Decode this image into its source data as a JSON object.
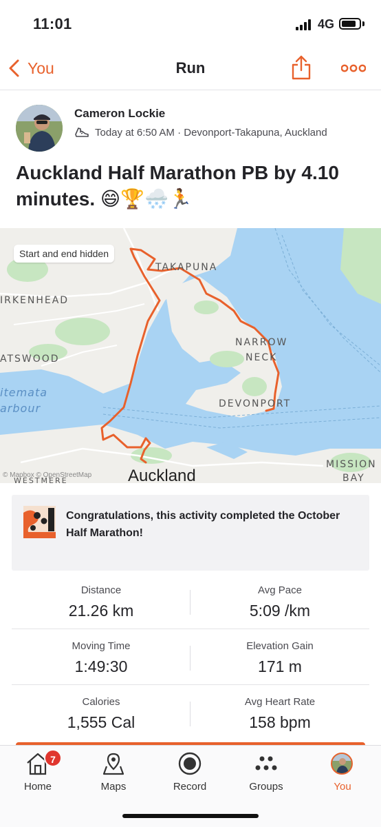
{
  "status_bar": {
    "time": "11:01",
    "network": "4G"
  },
  "nav": {
    "back_label": "You",
    "title": "Run"
  },
  "activity": {
    "athlete_name": "Cameron Lockie",
    "meta": "Today at 6:50 AM · Devonport-Takapuna, Auckland",
    "title": "Auckland Half Marathon PB by 4.10 minutes. 😄🏆🌨️🏃"
  },
  "map": {
    "privacy_chip": "Start and end hidden",
    "labels": {
      "takapuna": "TAKAPUNA",
      "birkenhead": "IRKENHEAD",
      "narrow": "NARROW",
      "neck": "NECK",
      "devonport": "DEVONPORT",
      "atswood": "ATSWOOD",
      "waitemata": "itemata",
      "harbour": "arbour",
      "mission": "MISSION",
      "bay": "BAY",
      "auckland": "Auckland",
      "westmere": "WESTMERE"
    },
    "attribution": "© Mapbox © OpenStreetMap"
  },
  "challenge": {
    "text": "Congratulations, this activity completed the October Half Marathon!"
  },
  "stats": [
    {
      "left": {
        "label": "Distance",
        "value": "21.26 km"
      },
      "right": {
        "label": "Avg Pace",
        "value": "5:09 /km"
      }
    },
    {
      "left": {
        "label": "Moving Time",
        "value": "1:49:30"
      },
      "right": {
        "label": "Elevation Gain",
        "value": "171 m"
      }
    },
    {
      "left": {
        "label": "Calories",
        "value": "1,555 Cal"
      },
      "right": {
        "label": "Avg Heart Rate",
        "value": "158 bpm"
      }
    }
  ],
  "tabs": [
    {
      "label": "Home",
      "icon": "home-icon",
      "badge": "7"
    },
    {
      "label": "Maps",
      "icon": "maps-icon"
    },
    {
      "label": "Record",
      "icon": "record-icon"
    },
    {
      "label": "Groups",
      "icon": "groups-icon"
    },
    {
      "label": "You",
      "icon": "profile-avatar",
      "active": true
    }
  ],
  "colors": {
    "accent": "#e8612c",
    "water": "#a9d3f3",
    "land": "#f0efeb",
    "park": "#c7e6c1",
    "badge": "#e0362e"
  }
}
